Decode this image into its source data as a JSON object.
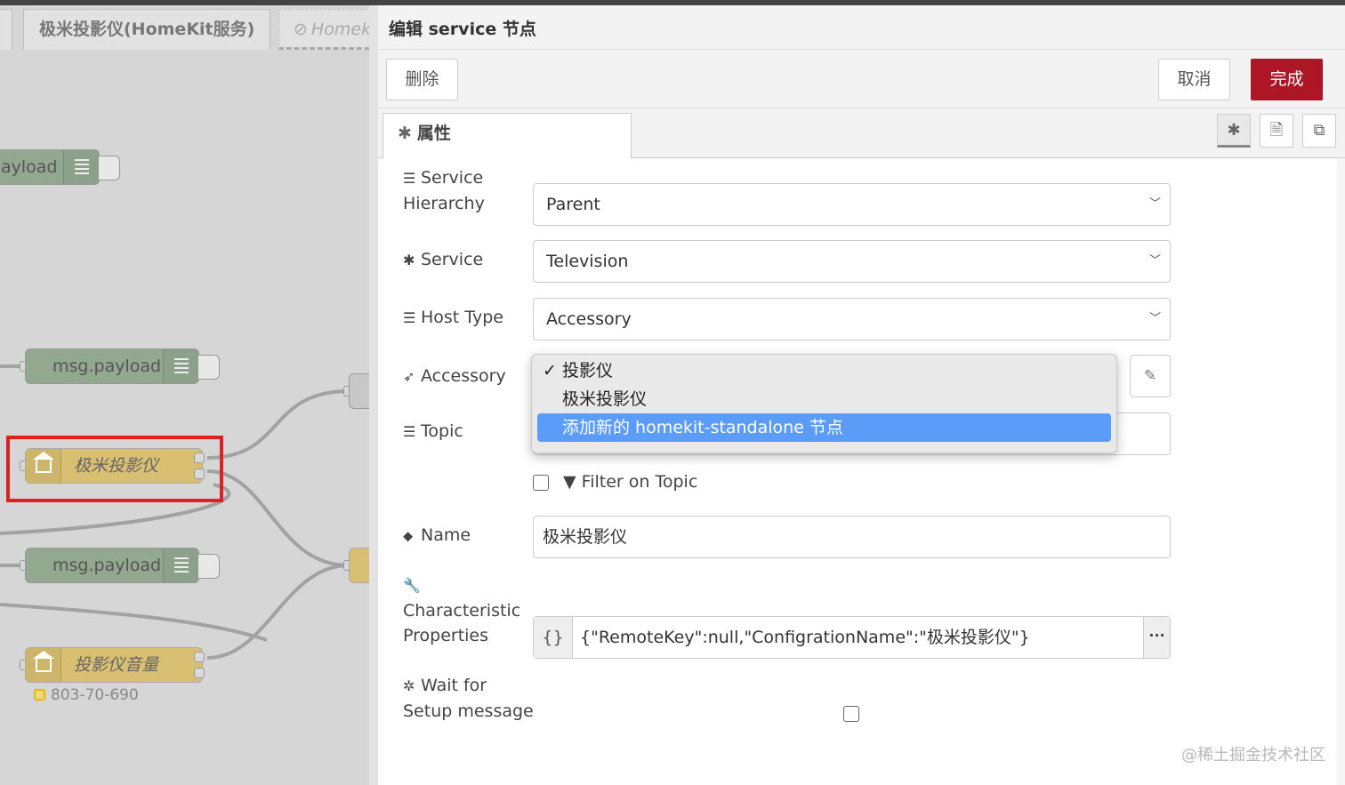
{
  "workspace": {
    "tabs": [
      {
        "label": ""
      },
      {
        "label": "极米投影仪(HomeKit服务)"
      },
      {
        "label": "Homek"
      }
    ],
    "nodes": [
      {
        "label": "ayload"
      },
      {
        "label": "msg.payload"
      },
      {
        "label": "极米投影仪"
      },
      {
        "label": "msg.payload"
      },
      {
        "label": "投影仪音量"
      }
    ],
    "status": "803-70-690"
  },
  "editor": {
    "title": "编辑 service 节点",
    "delete_label": "删除",
    "cancel_label": "取消",
    "done_label": "完成",
    "tab_properties": "属性",
    "fields": {
      "hierarchy_label_1": "Service",
      "hierarchy_label_2": "Hierarchy",
      "hierarchy_value": "Parent",
      "service_label": "Service",
      "service_value": "Television",
      "host_type_label": "Host Type",
      "host_type_value": "Accessory",
      "accessory_label": "Accessory",
      "topic_label": "Topic",
      "topic_value": "",
      "filter_label": "Filter on Topic",
      "filter_checked": false,
      "name_label": "Name",
      "name_value": "极米投影仪",
      "char_label_1": "Characteristic",
      "char_label_2": "Properties",
      "char_type": "{}",
      "char_value": "{\"RemoteKey\":null,\"ConfigrationName\":\"极米投影仪\"}",
      "char_expand": "···",
      "wait_label_1": "Wait for",
      "wait_label_2": "Setup message",
      "wait_checked": false
    },
    "accessory_dropdown": {
      "options": [
        {
          "label": "投影仪",
          "selected": true
        },
        {
          "label": "极米投影仪",
          "selected": false
        },
        {
          "label": "添加新的 homekit-standalone 节点",
          "selected": false,
          "highlighted": true
        }
      ],
      "check_mark": "✓"
    }
  },
  "watermark": "@稀土掘金技术社区",
  "colors": {
    "done_button": "#ad1625",
    "highlight": "#5a9cf8",
    "debug_node": "#92a88f",
    "homekit_node": "#d9bf72",
    "selection_box": "#e02020"
  }
}
